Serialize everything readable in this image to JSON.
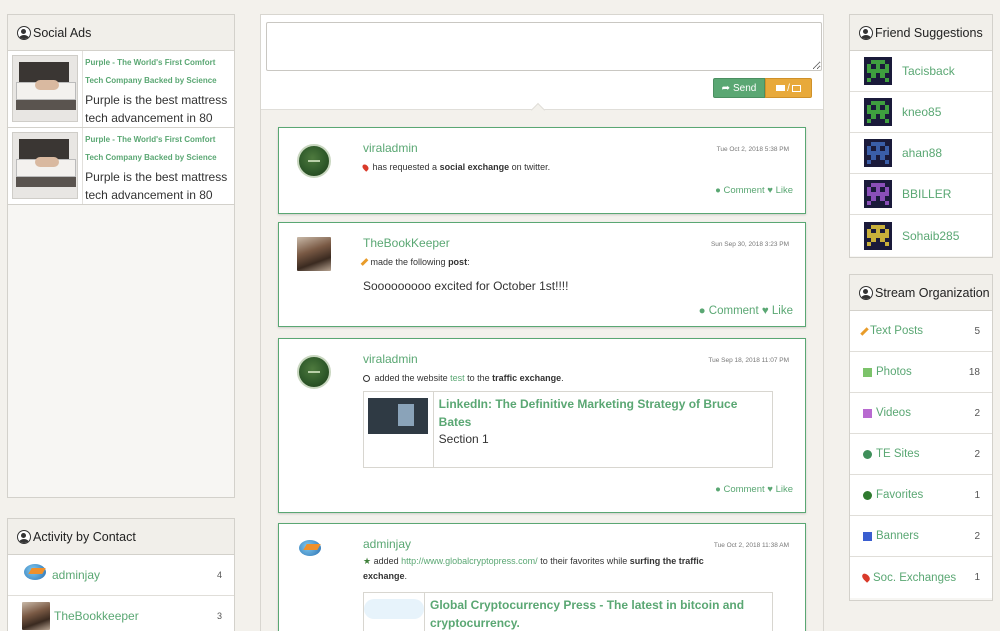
{
  "left": {
    "social_ads": {
      "title": "Social Ads",
      "ads": [
        {
          "title": "Purple - The World's First Comfort Tech Company Backed by Science",
          "description": "Purple is the best mattress tech advancement in 80"
        },
        {
          "title": "Purple - The World's First Comfort Tech Company Backed by Science",
          "description": "Purple is the best mattress tech advancement in 80"
        }
      ]
    },
    "activity": {
      "title": "Activity by Contact",
      "items": [
        {
          "name": "adminjay",
          "count": "4"
        },
        {
          "name": "TheBookkeeper",
          "count": "3"
        }
      ]
    }
  },
  "composer": {
    "placeholder": "",
    "send_label": "Send",
    "media_label": "/"
  },
  "posts": [
    {
      "user": "viraladmin",
      "time": "Tue Oct 2, 2018 5:38 PM",
      "pre": "has requested a ",
      "bold": "social exchange",
      "post": " on twitter.",
      "comment": "Comment",
      "like": "Like"
    },
    {
      "user": "TheBookKeeper",
      "time": "Sun Sep 30, 2018 3:23 PM",
      "pre": "made the following ",
      "bold": "post",
      "post": ":",
      "body": "Sooooooooo excited for October 1st!!!!",
      "comment": "Comment",
      "like": "Like"
    },
    {
      "user": "viraladmin",
      "time": "Tue Sep 18, 2018 11:07 PM",
      "pre": "added the website ",
      "link": "test",
      "mid": " to the ",
      "bold": "traffic exchange",
      "post": ".",
      "card_title": "LinkedIn: The Definitive Marketing Strategy of Bruce Bates",
      "card_sub": "Section 1",
      "comment": "Comment",
      "like": "Like"
    },
    {
      "user": "adminjay",
      "time": "Tue Oct 2, 2018 11:38 AM",
      "pre": "added ",
      "link": "http://www.globalcryptopress.com/",
      "mid": " to their favorites while ",
      "bold": "surfing the traffic exchange",
      "post": ".",
      "card_title": "Global Cryptocurrency Press - The latest in bitcoin and cryptocurrency."
    }
  ],
  "right": {
    "friends": {
      "title": "Friend Suggestions",
      "items": [
        {
          "name": "Tacisback",
          "color": "#3f9f3f"
        },
        {
          "name": "kneo85",
          "color": "#3f9f3f"
        },
        {
          "name": "ahan88",
          "color": "#3a5ea8"
        },
        {
          "name": "BBILLER",
          "color": "#8a4fb8"
        },
        {
          "name": "Sohaib285",
          "color": "#c9b03a"
        }
      ]
    },
    "stream": {
      "title": "Stream Organization",
      "items": [
        {
          "label": "Text Posts",
          "count": "5",
          "icon": "pencil-icon",
          "color": "#e89c2a"
        },
        {
          "label": "Photos",
          "count": "18",
          "icon": "photo-icon",
          "color": "#7cc36a"
        },
        {
          "label": "Videos",
          "count": "2",
          "icon": "video-icon",
          "color": "#b86ad0"
        },
        {
          "label": "TE Sites",
          "count": "2",
          "icon": "clock-icon",
          "color": "#3f8f5a"
        },
        {
          "label": "Favorites",
          "count": "1",
          "icon": "star-icon",
          "color": "#2f7a2f"
        },
        {
          "label": "Banners",
          "count": "2",
          "icon": "flag-icon",
          "color": "#3a5ed0"
        },
        {
          "label": "Soc. Exchanges",
          "count": "1",
          "icon": "flame-icon",
          "color": "#d93a2a"
        }
      ]
    }
  }
}
